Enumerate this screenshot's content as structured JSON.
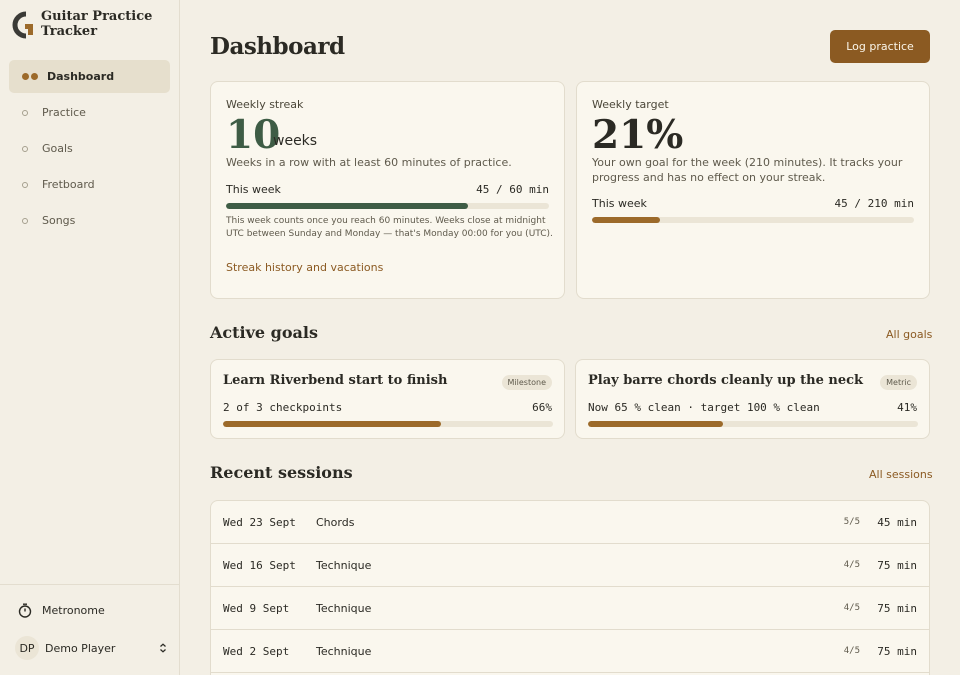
{
  "brand": {
    "name_line1": "Guitar Practice",
    "name_line2": "Tracker"
  },
  "nav": {
    "items": [
      {
        "label": "Dashboard",
        "active": true
      },
      {
        "label": "Practice",
        "active": false
      },
      {
        "label": "Goals",
        "active": false
      },
      {
        "label": "Fretboard",
        "active": false
      },
      {
        "label": "Songs",
        "active": false
      }
    ]
  },
  "sidebar_bottom": {
    "metronome": "Metronome",
    "user_initials": "DP",
    "user_name": "Demo Player"
  },
  "header": {
    "title": "Dashboard",
    "log_button": "Log practice"
  },
  "streak": {
    "label": "Weekly streak",
    "value": "10",
    "unit": "weeks",
    "desc": "Weeks in a row with at least 60 minutes of practice.",
    "week_label": "This week",
    "week_value": "45 / 60 min",
    "progress": 0.75,
    "note": "This week counts once you reach 60 minutes. Weeks close at midnight UTC between Sunday and Monday — that's Monday 00:00 for you (UTC).",
    "link": "Streak history and vacations"
  },
  "target": {
    "label": "Weekly target",
    "value": "21%",
    "desc": "Your own goal for the week (210 minutes). It tracks your progress and has no effect on your streak.",
    "week_label": "This week",
    "week_value": "45 / 210 min",
    "progress": 0.21
  },
  "active_goals": {
    "title": "Active goals",
    "link": "All goals",
    "goals": [
      {
        "title": "Learn Riverbend start to finish",
        "badge": "Milestone",
        "meta": "2 of 3 checkpoints",
        "pct": "66%",
        "progress": 0.66
      },
      {
        "title": "Play barre chords cleanly up the neck",
        "badge": "Metric",
        "meta": "Now 65 % clean · target 100 % clean",
        "pct": "41%",
        "progress": 0.41
      }
    ]
  },
  "recent_sessions": {
    "title": "Recent sessions",
    "link": "All sessions",
    "rows": [
      {
        "date": "Wed 23 Sept",
        "type": "Chords",
        "rating": "5/5",
        "minutes": "45 min"
      },
      {
        "date": "Wed 16 Sept",
        "type": "Technique",
        "rating": "4/5",
        "minutes": "75 min"
      },
      {
        "date": "Wed 9 Sept",
        "type": "Technique",
        "rating": "4/5",
        "minutes": "75 min"
      },
      {
        "date": "Wed 2 Sept",
        "type": "Technique",
        "rating": "4/5",
        "minutes": "75 min"
      }
    ]
  },
  "colors": {
    "accent": "#8b5a22",
    "progress_brown": "#9c6a2a",
    "streak_green": "#3e5c45",
    "background": "#f3efe5",
    "card": "#faf7ee"
  }
}
